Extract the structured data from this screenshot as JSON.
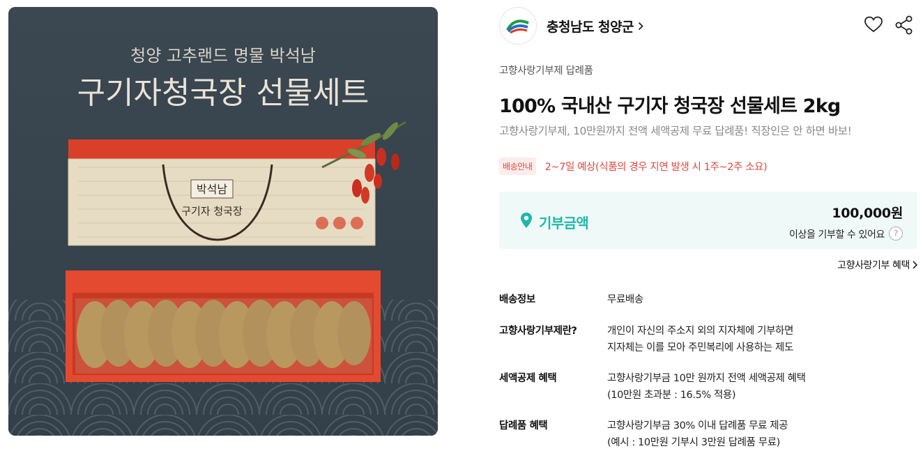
{
  "product_image": {
    "alt": "구기자청국장 선물세트",
    "headline_small": "청양 고추랜드 명물 박석남",
    "headline_large": "구기자청국장 선물세트",
    "box_brand": "박석남",
    "box_product": "구기자 청국장"
  },
  "seller": {
    "name": "충청남도 청양군",
    "logo_icon": "county-logo-icon"
  },
  "actions": {
    "like_icon": "heart-icon",
    "share_icon": "share-icon"
  },
  "product": {
    "category": "고향사랑기부제 답례품",
    "title": "100% 국내산 구기자 청국장 선물세트 2kg",
    "subtitle": "고향사랑기부제, 10만원까지 전액 세액공제 무료 답례품! 직장인은 안 하면 바보!"
  },
  "shipping": {
    "badge": "배송안내",
    "text": "2~7일 예상(식품의 경우 지연 발생 시 1주~2주 소요)"
  },
  "donation": {
    "label": "기부금액",
    "amount": "100,000원",
    "note": "이상을 기부할 수 있어요",
    "help": "?"
  },
  "benefit_link": "고향사랑기부 혜택",
  "info": [
    {
      "label": "배송정보",
      "lines": [
        "무료배송"
      ]
    },
    {
      "label": "고향사랑기부제란?",
      "lines": [
        "개인이 자신의 주소지 외의 지자체에 기부하면",
        "지자체는 이를 모아 주민복리에 사용하는 제도"
      ]
    },
    {
      "label": "세액공제 혜택",
      "lines": [
        "고향사랑기부금 10만 원까지 전액 세액공제 혜택",
        "(10만원 초과분 : 16.5% 적용)"
      ]
    },
    {
      "label": "답례품 혜택",
      "lines": [
        "고향사랑기부금 30% 이내 답례품 무료 제공",
        "(예시 : 10만원 기부시 3만원 답례품 무료)"
      ]
    }
  ],
  "colors": {
    "accent_teal": "#1fb7a9",
    "shipping_red": "#e0483e",
    "donation_bg": "#effaf8"
  }
}
